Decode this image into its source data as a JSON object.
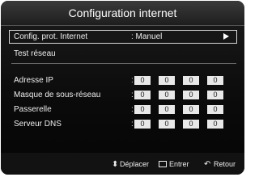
{
  "header": {
    "title": "Configuration internet"
  },
  "menu": {
    "config_label": "Config. prot. Internet",
    "config_value": ": Manuel",
    "test_label": "Test réseau"
  },
  "ip_fields": [
    {
      "label": "Adresse IP",
      "values": [
        "0",
        "0",
        "0",
        "0"
      ]
    },
    {
      "label": "Masque de sous-réseau",
      "values": [
        "0",
        "0",
        "0",
        "0"
      ]
    },
    {
      "label": "Passerelle",
      "values": [
        "0",
        "0",
        "0",
        "0"
      ]
    },
    {
      "label": "Serveur DNS",
      "values": [
        "0",
        "0",
        "0",
        "0"
      ]
    }
  ],
  "colon": ":",
  "footer": {
    "move_label": "Déplacer",
    "enter_label": "Entrer",
    "return_label": "Retour"
  },
  "icons": {
    "move": "move-icon",
    "enter": "enter-icon",
    "return": "return-icon",
    "arrow": "arrow-right-icon"
  }
}
